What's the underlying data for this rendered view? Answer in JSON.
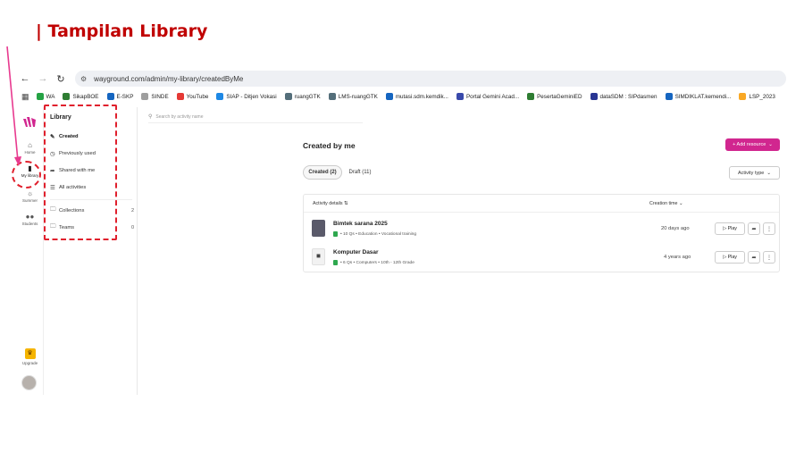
{
  "slide": {
    "title": "| Tampilan Library"
  },
  "browser": {
    "url": "wayground.com/admin/my-library/createdByMe",
    "bookmarks": [
      {
        "label": "WA",
        "color": "#25a244"
      },
      {
        "label": "SikapBOE",
        "color": "#2e7d32"
      },
      {
        "label": "E-SKP",
        "color": "#1565c0"
      },
      {
        "label": "SINDE",
        "color": "#9e9e9e"
      },
      {
        "label": "YouTube",
        "color": "#e53935"
      },
      {
        "label": "SIAP - Ditjen Vokasi",
        "color": "#1e88e5"
      },
      {
        "label": "ruangGTK",
        "color": "#546e7a"
      },
      {
        "label": "LMS-ruangGTK",
        "color": "#546e7a"
      },
      {
        "label": "mutasi.sdm.kemdik...",
        "color": "#1565c0"
      },
      {
        "label": "Portal Gemini Acad...",
        "color": "#3949ab"
      },
      {
        "label": "PesertaGeminiED",
        "color": "#2e7d32"
      },
      {
        "label": "dataSDM : SIPdasmen",
        "color": "#283593"
      },
      {
        "label": "SIMDIKLAT.kemendi...",
        "color": "#1565c0"
      },
      {
        "label": "LSP_2023",
        "color": "#f9a825"
      }
    ]
  },
  "rail": {
    "items": [
      {
        "label": "Home",
        "icon": "home-icon"
      },
      {
        "label": "My library",
        "icon": "library-icon"
      },
      {
        "label": "Summer",
        "icon": "summer-icon"
      },
      {
        "label": "Students",
        "icon": "students-icon"
      }
    ],
    "upgrade_label": "Upgrade"
  },
  "library": {
    "title": "Library",
    "items": [
      {
        "label": "Created",
        "icon": "pencil-icon",
        "count": ""
      },
      {
        "label": "Previously used",
        "icon": "clock-icon",
        "count": ""
      },
      {
        "label": "Shared with me",
        "icon": "share-icon",
        "count": ""
      },
      {
        "label": "All activities",
        "icon": "list-icon",
        "count": ""
      },
      {
        "label": "Collections",
        "icon": "folder-icon",
        "count": "2"
      },
      {
        "label": "Teams",
        "icon": "folder-icon",
        "count": "0"
      }
    ]
  },
  "main": {
    "search_placeholder": "Search by activity name",
    "page_title": "Created by me",
    "add_button": "+ Add resource",
    "tabs": [
      {
        "label": "Created (2)"
      },
      {
        "label": "Draft (11)"
      }
    ],
    "activity_type_button": "Activity type",
    "table": {
      "col_details": "Activity details",
      "col_time": "Creation time",
      "rows": [
        {
          "title": "Bimtek sarana 2025",
          "meta": "• 10 Qs • Education • Vocational training",
          "time": "20 days ago",
          "play": "Play"
        },
        {
          "title": "Komputer Dasar",
          "meta": "• 6 Qs • Computers • 10th - 12th Grade",
          "time": "4 years ago",
          "play": "Play"
        }
      ]
    }
  },
  "colors": {
    "accent": "#d1268f",
    "annotation": "#e0202d",
    "title": "#c00000"
  }
}
